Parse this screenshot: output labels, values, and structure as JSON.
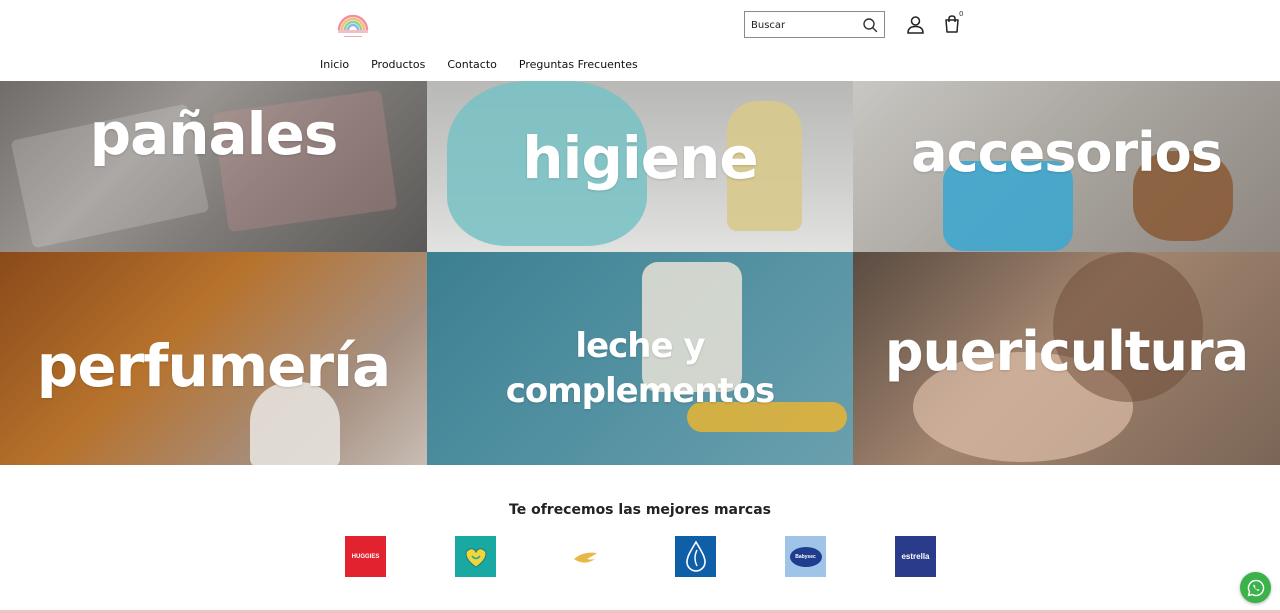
{
  "header": {
    "logo_icon": "rainbow-logo",
    "search": {
      "placeholder": "Buscar",
      "value": "",
      "icon": "search-icon"
    },
    "user_icon": "user-icon",
    "cart": {
      "icon": "shopping-bag-icon",
      "count": "0"
    }
  },
  "nav": {
    "items": [
      {
        "label": "Inicio"
      },
      {
        "label": "Productos"
      },
      {
        "label": "Contacto"
      },
      {
        "label": "Preguntas Frecuentes"
      }
    ]
  },
  "categories": [
    {
      "label": "pañales",
      "color": "#7d7a77"
    },
    {
      "label": "higiene",
      "color": "#cfcfcd"
    },
    {
      "label": "accesorios",
      "color": "#a8a49e"
    },
    {
      "label": "perfumería",
      "color": "#b7722c"
    },
    {
      "label_line1": "leche y",
      "label_line2": "complementos",
      "color": "#4f8fa0"
    },
    {
      "label": "puericultura",
      "color": "#a2856f"
    }
  ],
  "brands": {
    "title": "Te ofrecemos las mejores marcas",
    "items": [
      {
        "label": "HUGGIES",
        "color": "#e2232f"
      },
      {
        "label": "",
        "color": "#1aa8a3",
        "icon": "pampers-heart-icon"
      },
      {
        "label": "",
        "color": "#ffffff",
        "icon": "dove-bird-icon"
      },
      {
        "label": "",
        "color": "#0f5ea8",
        "icon": "johnson-drop-icon"
      },
      {
        "label": "Babysec",
        "color": "#9fc4e8"
      },
      {
        "label": "estrella",
        "color": "#2b3b8c"
      }
    ]
  },
  "whatsapp": {
    "icon": "whatsapp-icon",
    "color": "#3cb24a"
  }
}
